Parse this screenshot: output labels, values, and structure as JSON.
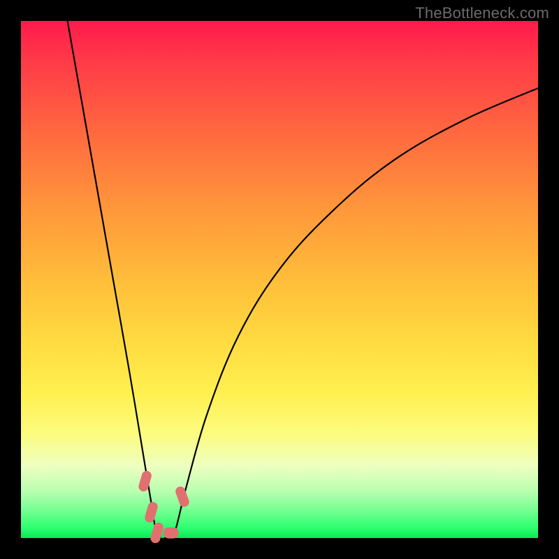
{
  "watermark": "TheBottleneck.com",
  "chart_data": {
    "type": "line",
    "title": "",
    "xlabel": "",
    "ylabel": "",
    "xlim": [
      0,
      100
    ],
    "ylim": [
      0,
      100
    ],
    "series": [
      {
        "name": "bottleneck-curve",
        "x": [
          9,
          12,
          15,
          18,
          21,
          24,
          25,
          26,
          27,
          28,
          29,
          30,
          32,
          36,
          42,
          50,
          60,
          72,
          86,
          100
        ],
        "y": [
          100,
          83,
          66,
          49,
          32,
          14,
          8,
          2,
          0,
          0,
          0,
          2,
          10,
          24,
          39,
          52,
          63,
          73,
          81,
          87
        ]
      }
    ],
    "markers": [
      {
        "name": "marker-left-upper",
        "x": 24.0,
        "y": 11.0
      },
      {
        "name": "marker-left-lower",
        "x": 25.2,
        "y": 5.0
      },
      {
        "name": "marker-bottom-left",
        "x": 26.3,
        "y": 1.0
      },
      {
        "name": "marker-bottom-right",
        "x": 29.0,
        "y": 1.0
      },
      {
        "name": "marker-right",
        "x": 31.2,
        "y": 8.0
      }
    ],
    "marker_color": "#e17070",
    "curve_color": "#000000"
  }
}
